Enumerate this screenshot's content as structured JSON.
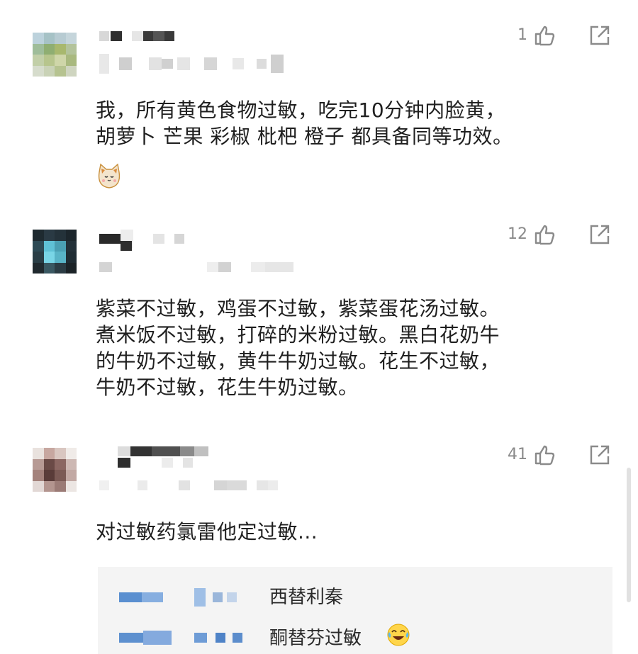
{
  "comments": [
    {
      "likes": "1",
      "lines": [
        "我，所有黄色食物过敏，吃完10分钟内脸黄，",
        "胡萝卜 芒果 彩椒 枇杷 橙子 都具备同等功效。"
      ],
      "emoji": "cat-face-emoji"
    },
    {
      "likes": "12",
      "lines": [
        "紫菜不过敏，鸡蛋不过敏，紫菜蛋花汤过敏。",
        "煮米饭不过敏，打碎的米粉过敏。黑白花奶牛",
        "的牛奶不过敏，黄牛牛奶过敏。花生不过敏，",
        "牛奶不过敏，花生牛奶过敏。"
      ]
    },
    {
      "likes": "41",
      "lines": [
        "对过敏药氯雷他定过敏..."
      ],
      "replies": [
        {
          "text": "西替利秦"
        },
        {
          "text": "酮替芬过敏",
          "emoji": "laughing-crying-emoji"
        }
      ]
    }
  ],
  "icons": {
    "like": "thumbs-up-icon",
    "share": "share-icon"
  },
  "colors": {
    "icon": "#8a8a8a",
    "text": "#1f1f1f",
    "reply_bg": "#f4f4f4"
  }
}
